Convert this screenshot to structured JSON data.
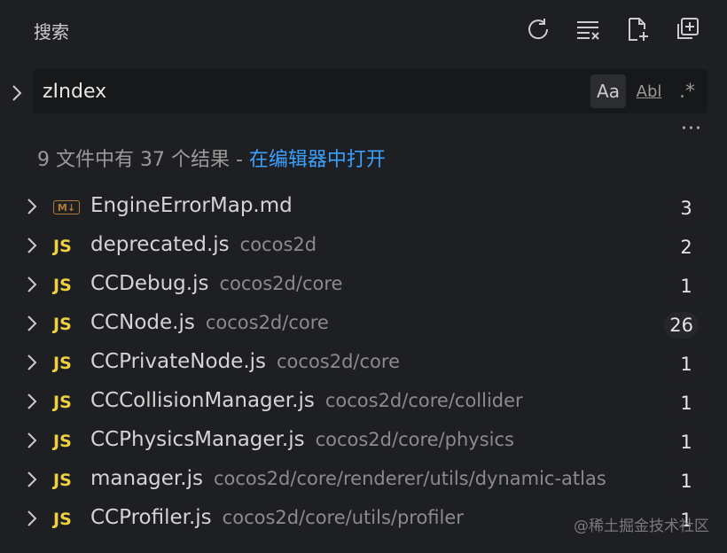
{
  "header": {
    "title": "搜索",
    "actions": [
      {
        "name": "refresh-icon"
      },
      {
        "name": "clear-results-icon"
      },
      {
        "name": "new-search-editor-icon"
      },
      {
        "name": "collapse-all-icon"
      }
    ]
  },
  "search": {
    "value": "zIndex",
    "options": {
      "match_case": "Aa",
      "whole_word": "Abl",
      "regex": ".*"
    }
  },
  "more_label": "···",
  "summary": {
    "text": "9 文件中有 37 个结果 - ",
    "link": "在编辑器中打开"
  },
  "results": [
    {
      "type": "md",
      "icon_text": "M↓",
      "name": "EngineErrorMap.md",
      "path": "",
      "count": "3"
    },
    {
      "type": "js",
      "icon_text": "JS",
      "name": "deprecated.js",
      "path": "cocos2d",
      "count": "2"
    },
    {
      "type": "js",
      "icon_text": "JS",
      "name": "CCDebug.js",
      "path": "cocos2d/core",
      "count": "1"
    },
    {
      "type": "js",
      "icon_text": "JS",
      "name": "CCNode.js",
      "path": "cocos2d/core",
      "count": "26"
    },
    {
      "type": "js",
      "icon_text": "JS",
      "name": "CCPrivateNode.js",
      "path": "cocos2d/core",
      "count": "1"
    },
    {
      "type": "js",
      "icon_text": "JS",
      "name": "CCCollisionManager.js",
      "path": "cocos2d/core/collider",
      "count": "1"
    },
    {
      "type": "js",
      "icon_text": "JS",
      "name": "CCPhysicsManager.js",
      "path": "cocos2d/core/physics",
      "count": "1"
    },
    {
      "type": "js",
      "icon_text": "JS",
      "name": "manager.js",
      "path": "cocos2d/core/renderer/utils/dynamic-atlas",
      "count": "1"
    },
    {
      "type": "js",
      "icon_text": "JS",
      "name": "CCProfiler.js",
      "path": "cocos2d/core/utils/profiler",
      "count": "1"
    }
  ],
  "watermark": "@稀土掘金技术社区",
  "colors": {
    "background": "#1e1f22",
    "link": "#3aa0ff",
    "js_badge": "#f0d03e",
    "md_badge": "#b07b3a"
  }
}
